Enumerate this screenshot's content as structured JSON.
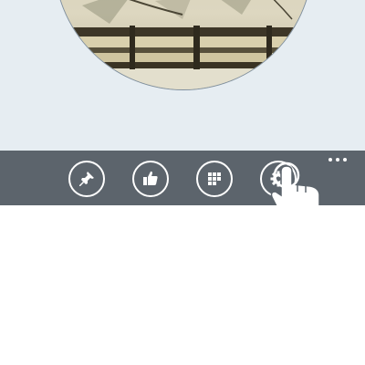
{
  "header": {
    "image_subject": "bamboo"
  },
  "app_bar": {
    "buttons": [
      {
        "icon": "pin-icon"
      },
      {
        "icon": "thumbs-up-icon"
      },
      {
        "icon": "apps-grid-icon"
      },
      {
        "icon": "gear-icon"
      }
    ],
    "more_icon": "ellipsis-icon"
  },
  "colors": {
    "background": "#e6edf2",
    "app_bar": "#5c646c",
    "icon": "#ffffff"
  }
}
